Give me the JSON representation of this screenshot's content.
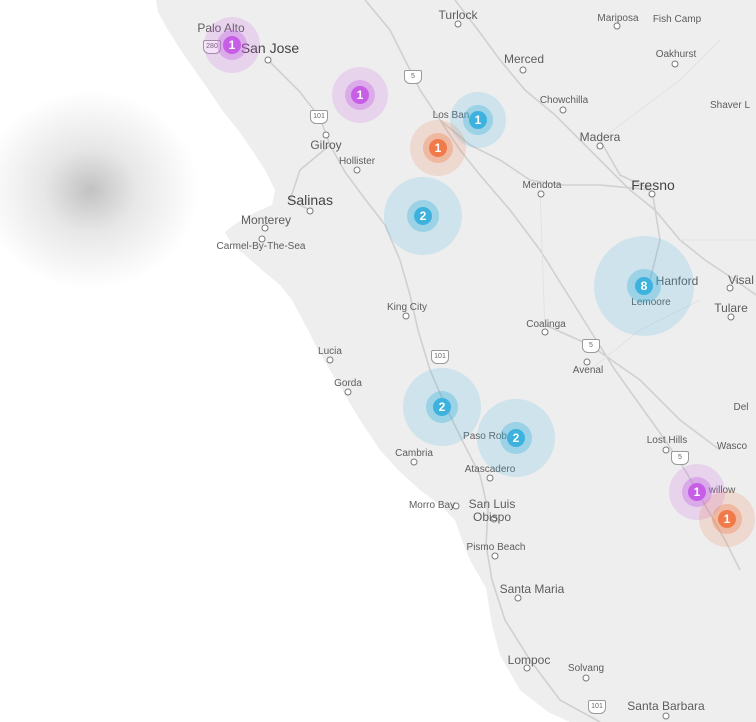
{
  "map": {
    "colors": {
      "land": "#eeeeee",
      "water": "#ffffff",
      "road": "#c8c8c8",
      "cluster_blue": "#3db2de",
      "cluster_purple": "#c65ee6",
      "cluster_orange": "#f07a4a"
    },
    "places": {
      "palo_alto": "Palo Alto",
      "san_jose": "San Jose",
      "turlock": "Turlock",
      "mariposa": "Mariposa",
      "fish_camp": "Fish Camp",
      "oakhurst": "Oakhurst",
      "merced": "Merced",
      "shaver_lake": "Shaver L",
      "chowchilla": "Chowchilla",
      "los_banos": "Los Ban",
      "gilroy": "Gilroy",
      "hollister": "Hollister",
      "madera": "Madera",
      "fresno": "Fresno",
      "mendota": "Mendota",
      "salinas": "Salinas",
      "monterey": "Monterey",
      "carmel": "Carmel-By-The-Sea",
      "hanford": "Hanford",
      "visalia": "Visal",
      "lemoore": "Lemoore",
      "tulare": "Tulare",
      "king_city": "King City",
      "coalinga": "Coalinga",
      "lucia": "Lucia",
      "avenal": "Avenal",
      "gorda": "Gorda",
      "delano": "Del",
      "paso_robles": "Paso Rob",
      "lost_hills": "Lost Hills",
      "wasco": "Wasco",
      "cambria": "Cambria",
      "atascadero": "Atascadero",
      "buttonwillow": "willow",
      "morro_bay": "Morro Bay",
      "slo_line1": "San Luis",
      "slo_line2": "Obispo",
      "pismo_beach": "Pismo Beach",
      "santa_maria": "Santa Maria",
      "lompoc": "Lompoc",
      "solvang": "Solvang",
      "santa_barbara": "Santa Barbara"
    },
    "shields": {
      "i280": "280",
      "i5_north": "5",
      "us101_north": "101",
      "us101_mid": "101",
      "i5_mid": "5",
      "i5_south": "5",
      "us101_south": "101"
    },
    "clusters": [
      {
        "id": "palo-alto",
        "count": "1",
        "color": "purple"
      },
      {
        "id": "gilroy-north",
        "count": "1",
        "color": "purple"
      },
      {
        "id": "los-banos",
        "count": "1",
        "color": "blue"
      },
      {
        "id": "los-banos-south",
        "count": "1",
        "color": "orange"
      },
      {
        "id": "panoche",
        "count": "2",
        "color": "blue"
      },
      {
        "id": "hanford",
        "count": "8",
        "color": "blue"
      },
      {
        "id": "cambria-east",
        "count": "2",
        "color": "blue"
      },
      {
        "id": "paso-robles",
        "count": "2",
        "color": "blue"
      },
      {
        "id": "buttonwillow",
        "count": "1",
        "color": "purple"
      },
      {
        "id": "bakersfield-west",
        "count": "1",
        "color": "orange"
      }
    ]
  }
}
